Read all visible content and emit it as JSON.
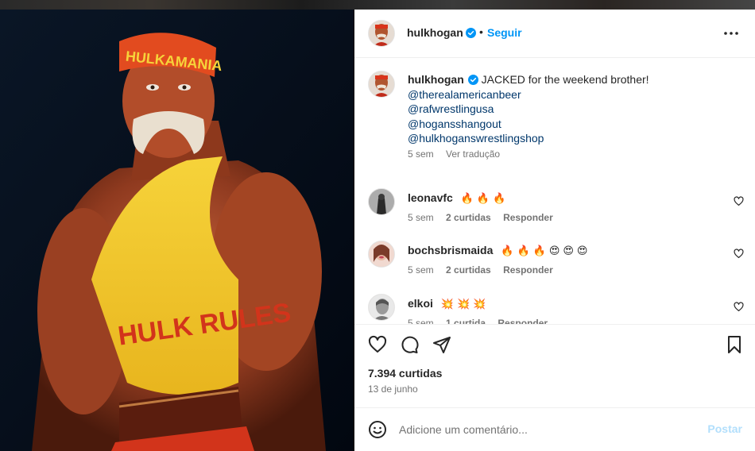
{
  "post": {
    "username": "hulkhogan",
    "follow_label": "Seguir",
    "dot": "•"
  },
  "caption": {
    "username": "hulkhogan",
    "text": "JACKED for the weekend brother!",
    "mentions": [
      "@therealamericanbeer",
      "@rafwrestlingusa",
      "@hogansshangout",
      "@hulkhoganswrestlingshop"
    ],
    "time": "5 sem",
    "translate_label": "Ver tradução"
  },
  "comments": [
    {
      "username": "leonavfc",
      "text": "🔥🔥🔥",
      "time": "5 sem",
      "likes": "2 curtidas",
      "reply_label": "Responder"
    },
    {
      "username": "bochsbrismaida",
      "text": "🔥🔥🔥😍😍😍",
      "time": "5 sem",
      "likes": "2 curtidas",
      "reply_label": "Responder"
    },
    {
      "username": "elkoi",
      "text": "💥💥💥",
      "time": "5 sem",
      "likes": "1 curtida",
      "reply_label": "Responder"
    }
  ],
  "stats": {
    "likes": "7.394 curtidas",
    "date": "13 de junho"
  },
  "add_comment": {
    "placeholder": "Adicione um comentário...",
    "post_label": "Postar"
  },
  "photo": {
    "headband_text": "HULKAMANIA",
    "shirt_text": "HULK RULES"
  },
  "colors": {
    "link": "#00376b",
    "accent": "#0095f6",
    "verified": "#0095f6",
    "muted": "#737373"
  },
  "icons": [
    "heart-icon",
    "comment-icon",
    "share-icon",
    "bookmark-icon",
    "smiley-icon",
    "more-icon",
    "verified-badge-icon"
  ]
}
